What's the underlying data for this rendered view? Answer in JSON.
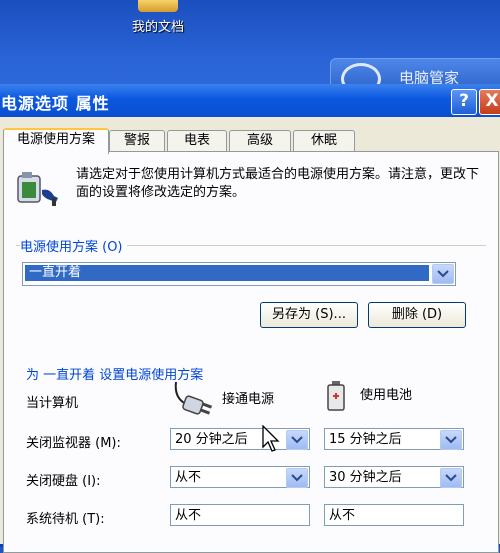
{
  "desktop": {
    "my_documents_label": "我的文档",
    "badge_label": "电脑管家"
  },
  "window": {
    "title": "电源选项 属性",
    "help_label": "?",
    "close_label": "X"
  },
  "tabs": [
    {
      "label": "电源使用方案",
      "active": true
    },
    {
      "label": "警报",
      "active": false
    },
    {
      "label": "电表",
      "active": false
    },
    {
      "label": "高级",
      "active": false
    },
    {
      "label": "休眠",
      "active": false
    }
  ],
  "description": "请选定对于您使用计算机方式最适合的电源使用方案。请注意，更改下面的设置将修改选定的方案。",
  "scheme": {
    "group_label": "电源使用方案 (O)",
    "selected": "一直开着",
    "save_as_label": "另存为 (S)...",
    "delete_label": "删除 (D)"
  },
  "settings": {
    "title": "为 一直开着 设置电源使用方案",
    "computer_label": "当计算机",
    "plugged_in_label": "接通电源",
    "battery_label": "使用电池",
    "rows": [
      {
        "label": "关闭监视器 (M):",
        "ac": "20 分钟之后",
        "dc": "15 分钟之后"
      },
      {
        "label": "关闭硬盘 (I):",
        "ac": "从不",
        "dc": "30 分钟之后"
      },
      {
        "label": "系统待机 (T):",
        "ac": "从不",
        "dc": "从不"
      }
    ]
  },
  "colors": {
    "title_bar": "#0a4fd0",
    "selection": "#316ac5",
    "link_text": "#0046d5"
  }
}
